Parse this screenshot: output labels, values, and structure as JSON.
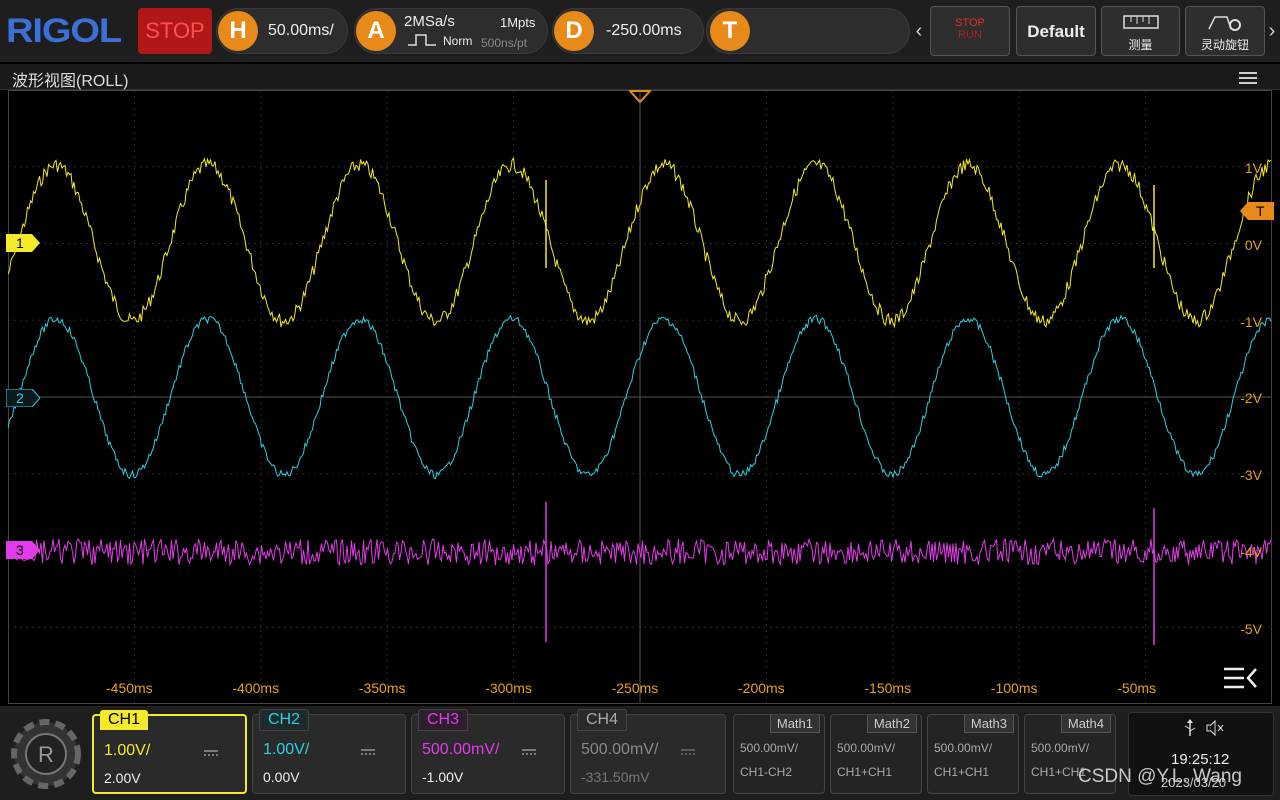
{
  "brand": "RIGOL",
  "run_state": "STOP",
  "horizontal": {
    "icon_letter": "H",
    "timebase": "50.00ms/"
  },
  "acquire": {
    "icon_letter": "A",
    "sample_rate": "2MSa/s",
    "memory_depth": "1Mpts",
    "mode": "Norm",
    "sample_interval": "500ns/pt"
  },
  "delay": {
    "icon_letter": "D",
    "offset": "-250.00ms"
  },
  "trigger": {
    "icon_letter": "T"
  },
  "toolbar": {
    "stop_run_top": "STOP",
    "stop_run_bottom": "RUN",
    "default_label": "Default",
    "measure_label": "测量",
    "knob_label": "灵动旋钮"
  },
  "window_title": "波形视图(ROLL)",
  "x_ticks": [
    "-450ms",
    "-400ms",
    "-350ms",
    "-300ms",
    "-250ms",
    "-200ms",
    "-150ms",
    "-100ms",
    "-50ms"
  ],
  "y_ticks": [
    "1V",
    "0V",
    "-1V",
    "-2V",
    "-3V",
    "-4V",
    "-5V"
  ],
  "trigger_marker": "T",
  "channel_markers": [
    "1",
    "2",
    "3"
  ],
  "colors": {
    "ch1": "#f2ea2b",
    "ch2": "#2fd0e0",
    "ch3": "#e23ce8",
    "ch4": "#888888",
    "orange": "#e88a1a",
    "tick": "#e8a020"
  },
  "channels": [
    {
      "name": "CH1",
      "scale": "1.00V/",
      "offset": "2.00V",
      "color": "#f2ea2b",
      "active": true
    },
    {
      "name": "CH2",
      "scale": "1.00V/",
      "offset": "0.00V",
      "color": "#2fd0e0",
      "active": false
    },
    {
      "name": "CH3",
      "scale": "500.00mV/",
      "offset": "-1.00V",
      "color": "#e23ce8",
      "active": false
    },
    {
      "name": "CH4",
      "scale": "500.00mV/",
      "offset": "-331.50mV",
      "color": "#888888",
      "active": false
    }
  ],
  "maths": [
    {
      "name": "Math1",
      "scale": "500.00mV/",
      "expr": "CH1-CH2"
    },
    {
      "name": "Math2",
      "scale": "500.00mV/",
      "expr": "CH1+CH1"
    },
    {
      "name": "Math3",
      "scale": "500.00mV/",
      "expr": "CH1+CH1"
    },
    {
      "name": "Math4",
      "scale": "500.00mV/",
      "expr": "CH1+CH1"
    }
  ],
  "status": {
    "time": "19:25:12",
    "date": "2023/03/20"
  },
  "watermark": "CSDN @Y.L. Wang"
}
